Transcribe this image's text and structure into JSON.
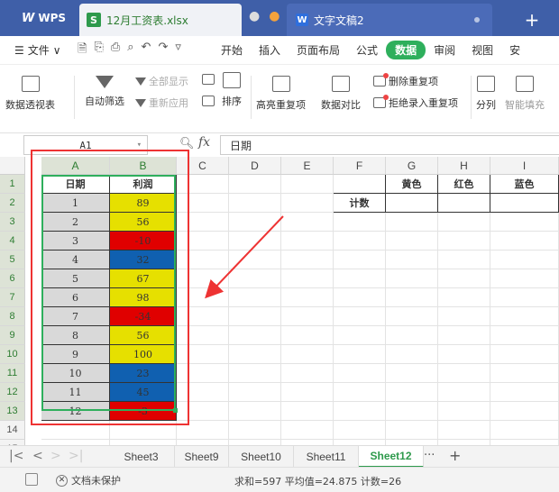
{
  "titlebar": {
    "app_label": "WPS",
    "file_tab": "12月工资表.xlsx",
    "doc_tab": "文字文稿2",
    "new_tab": "+"
  },
  "menubar": {
    "file": "文件",
    "items": [
      "开始",
      "插入",
      "页面布局",
      "公式",
      "数据",
      "审阅",
      "视图",
      "安"
    ],
    "active": "数据"
  },
  "ribbon": {
    "pivot": "数据透视表",
    "autofilter": "自动筛选",
    "show_all": "全部显示",
    "reapply": "重新应用",
    "sort": "排序",
    "highlight_dup": "高亮重复项",
    "compare": "数据对比",
    "remove_dup": "删除重复项",
    "reject_dup": "拒绝录入重复项",
    "split": "分列",
    "smart_fill": "智能填充"
  },
  "formula_bar": {
    "name_box": "A1",
    "fx": "fx",
    "content": "日期"
  },
  "grid": {
    "columns": [
      "A",
      "B",
      "C",
      "D",
      "E",
      "F",
      "G",
      "H",
      "I"
    ],
    "rows": [
      "1",
      "2",
      "3",
      "4",
      "5",
      "6",
      "7",
      "8",
      "9",
      "10",
      "11",
      "12",
      "13",
      "14",
      "15"
    ],
    "headers": {
      "a1": "日期",
      "b1": "利润",
      "g1": "黄色",
      "h1": "红色",
      "i1": "蓝色",
      "f2": "计数"
    },
    "data": [
      {
        "date": "1",
        "profit": "89",
        "color": "#e6e000"
      },
      {
        "date": "2",
        "profit": "56",
        "color": "#e6e000"
      },
      {
        "date": "3",
        "profit": "-10",
        "color": "#e00000"
      },
      {
        "date": "4",
        "profit": "32",
        "color": "#1060b0"
      },
      {
        "date": "5",
        "profit": "67",
        "color": "#e6e000"
      },
      {
        "date": "6",
        "profit": "98",
        "color": "#e6e000"
      },
      {
        "date": "7",
        "profit": "-34",
        "color": "#e00000"
      },
      {
        "date": "8",
        "profit": "56",
        "color": "#e6e000"
      },
      {
        "date": "9",
        "profit": "100",
        "color": "#e6e000"
      },
      {
        "date": "10",
        "profit": "23",
        "color": "#1060b0"
      },
      {
        "date": "11",
        "profit": "45",
        "color": "#1060b0"
      },
      {
        "date": "12",
        "profit": "-3",
        "color": "#e00000"
      }
    ]
  },
  "sheets": {
    "tabs": [
      "Sheet3",
      "Sheet9",
      "Sheet10",
      "Sheet11",
      "Sheet12"
    ],
    "active": "Sheet12",
    "more": "···",
    "add": "+"
  },
  "statusbar": {
    "protect": "文档未保护",
    "summary": "求和=597  平均值=24.875  计数=26"
  }
}
